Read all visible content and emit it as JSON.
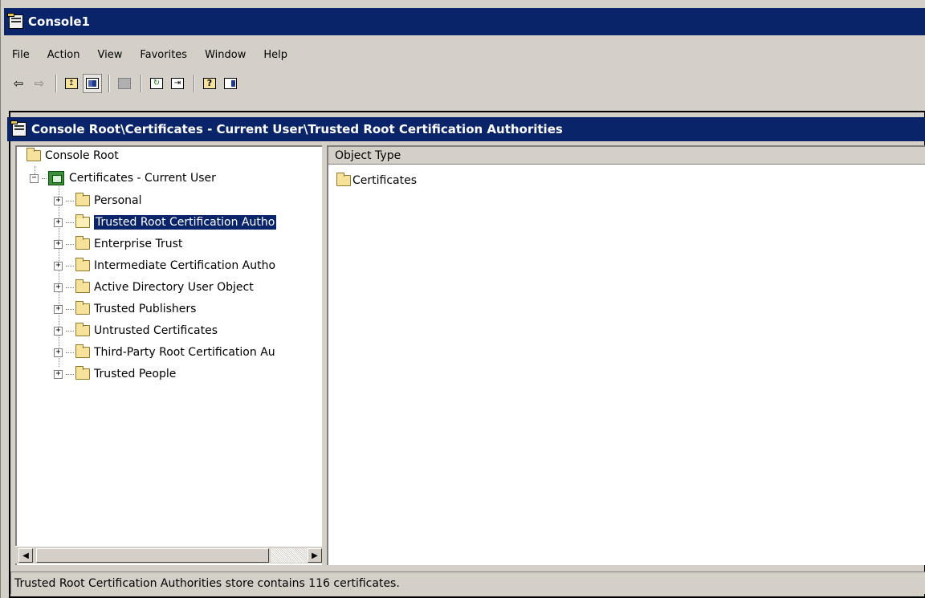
{
  "window": {
    "title": "Console1"
  },
  "menu": [
    "File",
    "Action",
    "View",
    "Favorites",
    "Window",
    "Help"
  ],
  "toolbar": {
    "buttons": [
      {
        "name": "back-arrow-icon"
      },
      {
        "name": "forward-arrow-icon"
      },
      {
        "name": "up-one-level-icon"
      },
      {
        "name": "show-hide-console-tree-icon"
      },
      {
        "name": "delete-icon"
      },
      {
        "name": "refresh-icon"
      },
      {
        "name": "export-list-icon"
      },
      {
        "name": "help-icon"
      },
      {
        "name": "show-hide-action-pane-icon"
      }
    ]
  },
  "document": {
    "title": "Console Root\\Certificates - Current User\\Trusted Root Certification Authorities"
  },
  "tree": {
    "root": "Console Root",
    "child": "Certificates - Current User",
    "items": [
      "Personal",
      "Trusted Root Certification Autho",
      "Enterprise Trust",
      "Intermediate Certification Autho",
      "Active Directory User Object",
      "Trusted Publishers",
      "Untrusted Certificates",
      "Third-Party Root Certification Au",
      "Trusted People"
    ],
    "selected_index": 1
  },
  "list": {
    "column": "Object Type",
    "rows": [
      "Certificates"
    ]
  },
  "status": {
    "text": "Trusted Root Certification Authorities store contains 116 certificates."
  }
}
